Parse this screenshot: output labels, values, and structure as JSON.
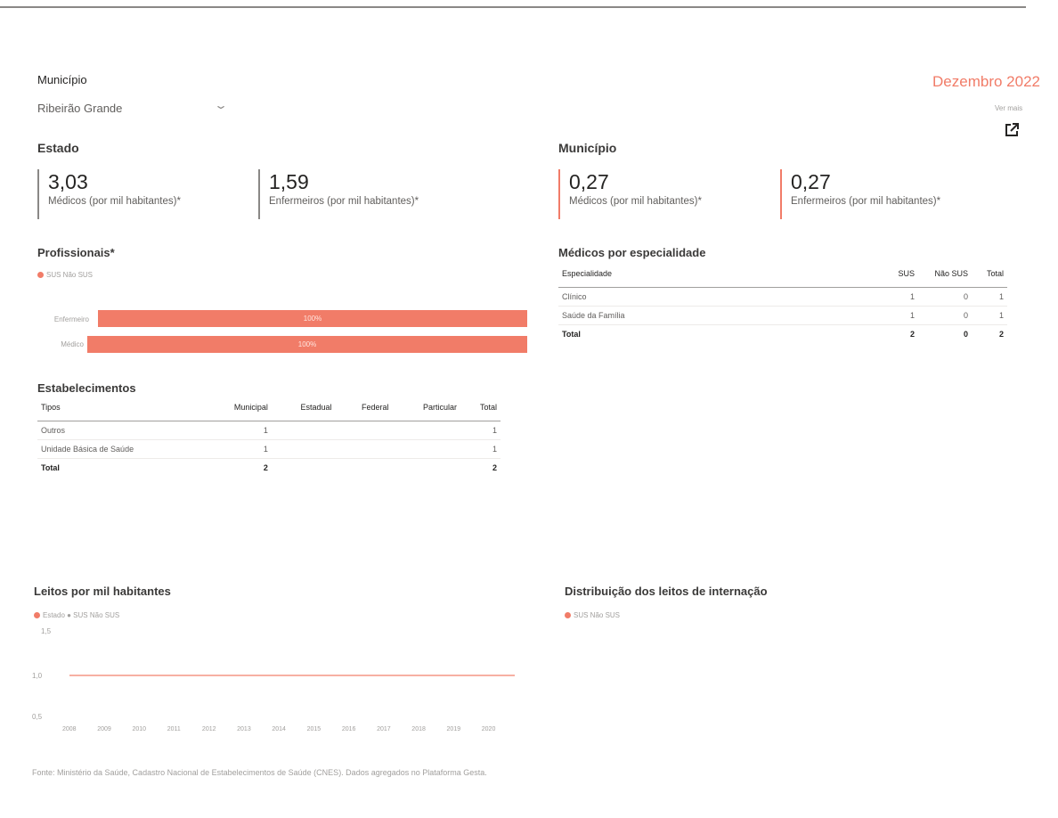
{
  "slicer": {
    "title": "Município",
    "value": "Ribeirão Grande"
  },
  "header": {
    "month": "Dezembro 2022",
    "link_text": "Ver mais"
  },
  "estado": {
    "title": "Estado",
    "medicos": {
      "value": "3,03",
      "caption": "Médicos (por mil habitantes)*"
    },
    "enfermeiros": {
      "value": "1,59",
      "caption": "Enfermeiros (por mil habitantes)*"
    }
  },
  "municipio": {
    "title": "Município",
    "medicos": {
      "value": "0,27",
      "caption": "Médicos (por mil habitantes)*"
    },
    "enfermeiros": {
      "value": "0,27",
      "caption": "Enfermeiros (por mil habitantes)*"
    }
  },
  "profissionais": {
    "title": "Profissionais*",
    "legend": "SUS Não SUS",
    "bars": [
      {
        "label": "Enfermeiro",
        "text": "100%"
      },
      {
        "label": "Médico",
        "text": "100%"
      }
    ]
  },
  "especialidade": {
    "title": "Médicos por especialidade",
    "headers": [
      "Especialidade",
      "SUS",
      "Não SUS",
      "Total"
    ],
    "rows": [
      [
        "Clínico",
        "1",
        "0",
        "1"
      ],
      [
        "Saúde da Família",
        "1",
        "0",
        "1"
      ]
    ],
    "total": [
      "Total",
      "2",
      "0",
      "2"
    ]
  },
  "estabelecimentos": {
    "title": "Estabelecimentos",
    "headers": [
      "Tipos",
      "Municipal",
      "Estadual",
      "Federal",
      "Particular",
      "Total"
    ],
    "rows": [
      [
        "Outros",
        "1",
        "",
        "",
        "",
        "1"
      ],
      [
        "Unidade Básica de Saúde",
        "1",
        "",
        "",
        "",
        "1"
      ]
    ],
    "total": [
      "Total",
      "2",
      "",
      "",
      "",
      "2"
    ]
  },
  "leitos": {
    "title": "Leitos por mil habitantes",
    "legend": "Estado ● SUS Não SUS",
    "y_top": "1,5",
    "y_mid": "1,0",
    "y_bottom": "0,5",
    "x_ticks": [
      "2008",
      "2009",
      "2010",
      "2011",
      "2012",
      "2013",
      "2014",
      "2015",
      "2016",
      "2017",
      "2018",
      "2019",
      "2020"
    ]
  },
  "distribuicao": {
    "title": "Distribuição dos leitos de internação",
    "legend": "SUS Não SUS"
  },
  "footnote": "Fonte: Ministério da Saúde, Cadastro Nacional de Estabelecimentos de Saúde (CNES). Dados agregados no Plataforma Gesta."
}
